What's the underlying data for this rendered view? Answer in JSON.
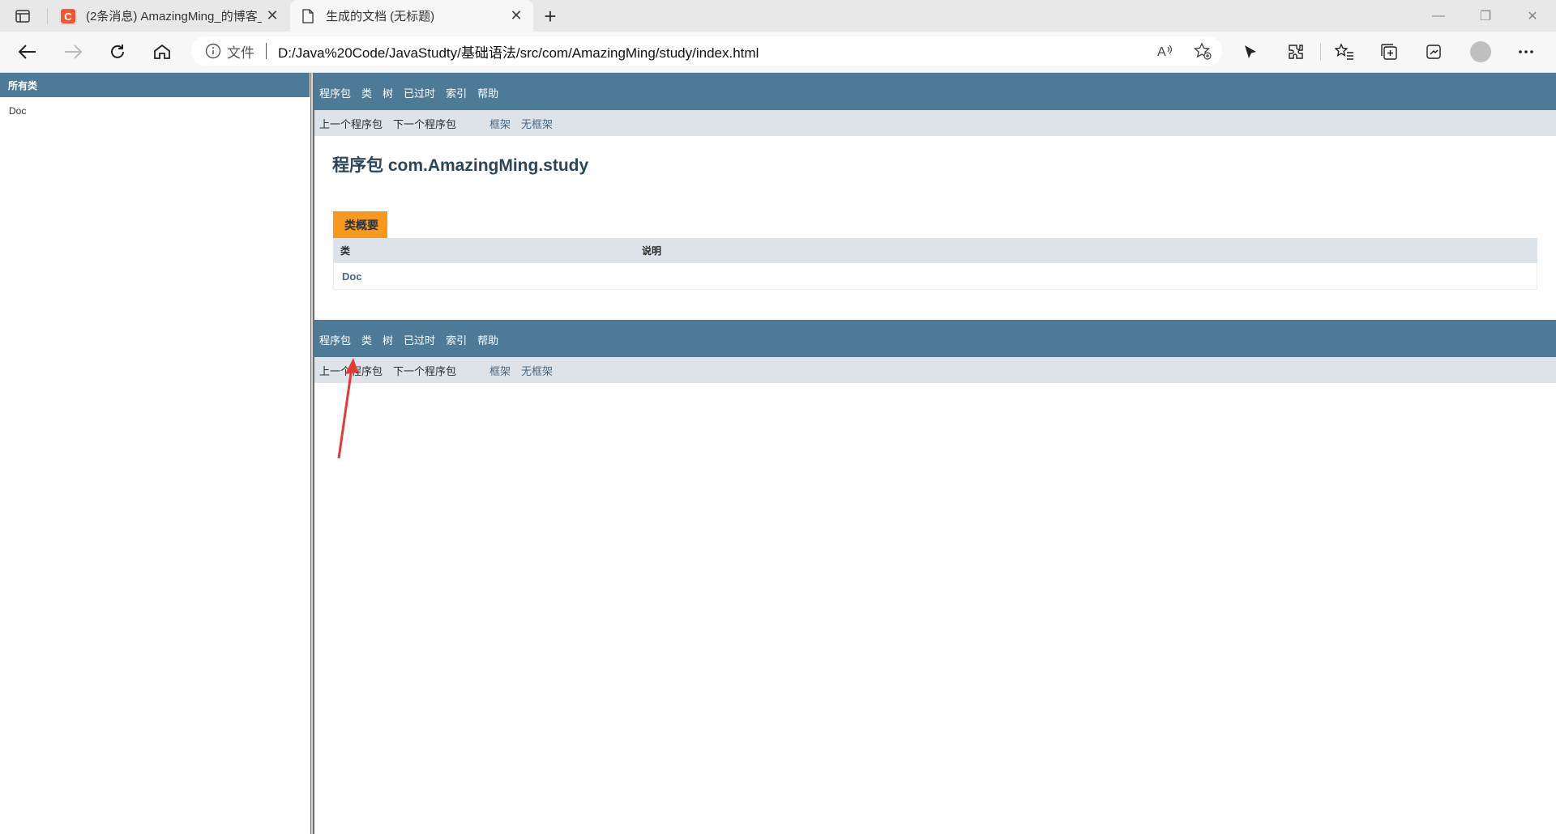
{
  "browser": {
    "tabs": [
      {
        "title": "(2条消息) AmazingMing_的博客_",
        "active": false
      },
      {
        "title": "生成的文档 (无标题)",
        "active": true
      }
    ],
    "address": {
      "security_label": "文件",
      "url": "D:/Java%20Code/JavaStudty/基础语法/src/com/AmazingMing/study/index.html"
    }
  },
  "left_frame": {
    "header": "所有类",
    "classes": [
      "Doc"
    ]
  },
  "nav": {
    "top_items": [
      "程序包",
      "类",
      "树",
      "已过时",
      "索引",
      "帮助"
    ],
    "prev_pkg": "上一个程序包",
    "next_pkg": "下一个程序包",
    "frames": "框架",
    "no_frames": "无框架"
  },
  "main": {
    "package_title": "程序包 com.AmazingMing.study",
    "summary_caption": "类概要",
    "col_class": "类",
    "col_desc": "说明",
    "rows": [
      {
        "class": "Doc",
        "desc": ""
      }
    ]
  },
  "colors": {
    "nav_blue": "#4d7a97",
    "subnav": "#dee3e9",
    "caption_orange": "#f8981d",
    "arrow_red": "#e53935"
  }
}
